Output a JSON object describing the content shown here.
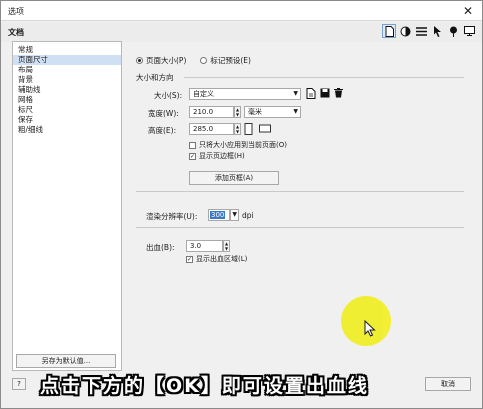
{
  "window": {
    "title": "选项",
    "close_glyph": "✕"
  },
  "header": {
    "title": "文档",
    "icons": [
      "page-icon",
      "color-icon",
      "lines-icon",
      "pointer-icon",
      "pin-icon",
      "monitor-icon"
    ]
  },
  "sidebar": {
    "items": [
      {
        "label": "常规"
      },
      {
        "label": "页面尺寸",
        "selected": true
      },
      {
        "label": "布局"
      },
      {
        "label": "背景"
      },
      {
        "label": "辅助线"
      },
      {
        "label": "网格"
      },
      {
        "label": "标尺"
      },
      {
        "label": "保存"
      },
      {
        "label": "粗/细线"
      }
    ],
    "save_default_label": "另存为默认值..."
  },
  "main": {
    "radio_page_size": "页面大小(P)",
    "radio_label_preset": "标记预设(E)",
    "group_size_orientation": "大小和方向",
    "size_label": "大小(S):",
    "size_value": "自定义",
    "width_label": "宽度(W):",
    "width_value": "210.0",
    "unit_value": "毫米",
    "height_label": "高度(E):",
    "height_value": "285.0",
    "apply_current_only": "只将大小应用到当前页面(O)",
    "apply_current_only_checked": false,
    "show_page_border": "显示页边框(H)",
    "show_page_border_checked": true,
    "add_page_frame_button": "添加页框(A)",
    "render_resolution_label": "渲染分辨率(U):",
    "render_resolution_value": "300",
    "render_resolution_unit": "dpi",
    "bleed_label": "出血(B):",
    "bleed_value": "3.0",
    "show_bleed_area": "显示出血区域(L)",
    "show_bleed_area_checked": true
  },
  "footer": {
    "help_label": "?",
    "cancel_label": "取消"
  },
  "overlay_caption": "点击下方的【OK】即可设置出血线",
  "colors": {
    "selection": "#cfe0f4",
    "highlight_value": "#3a78c8",
    "cursor_spot": "#f1ee2c"
  }
}
